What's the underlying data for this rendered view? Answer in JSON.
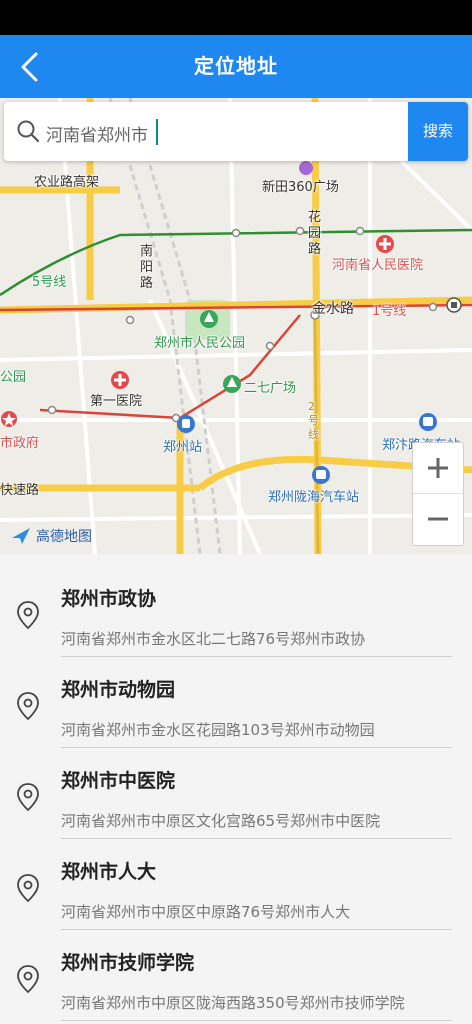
{
  "header": {
    "title": "定位地址",
    "back_icon": "chevron-left-icon",
    "bg_color": "#1e87f0"
  },
  "search": {
    "value": "河南省郑州市",
    "button_label": "搜索",
    "icon": "search-icon"
  },
  "map": {
    "labels": {
      "nongye": "农业路高架",
      "xintian": "新田360广场",
      "huayuan": "花园路",
      "renmin_hospital": "河南省人民医院",
      "nanyang": "南阳路",
      "line5": "5号线",
      "jinshui": "金水路",
      "line1": "1号线",
      "people_park": "郑州市人民公园",
      "erqi": "二七广场",
      "first_hospital": "第一医院",
      "gongyuan": "公园",
      "city_gov": "市政府",
      "zz_station": "郑州站",
      "line2": "2号线",
      "zhengbian": "郑汴路汽车站",
      "kuaisu": "快速路",
      "longhai": "郑州陇海汽车站"
    },
    "logo": "高德地图",
    "zoom_in": "+",
    "zoom_out": "−"
  },
  "results": [
    {
      "name": "郑州市政协",
      "address": "河南省郑州市金水区北二七路76号郑州市政协"
    },
    {
      "name": "郑州市动物园",
      "address": "河南省郑州市金水区花园路103号郑州市动物园"
    },
    {
      "name": "郑州市中医院",
      "address": "河南省郑州市中原区文化宫路65号郑州市中医院"
    },
    {
      "name": "郑州市人大",
      "address": "河南省郑州市中原区中原路76号郑州市人大"
    },
    {
      "name": "郑州市技师学院",
      "address": "河南省郑州市中原区陇海西路350号郑州市技师学院"
    }
  ]
}
